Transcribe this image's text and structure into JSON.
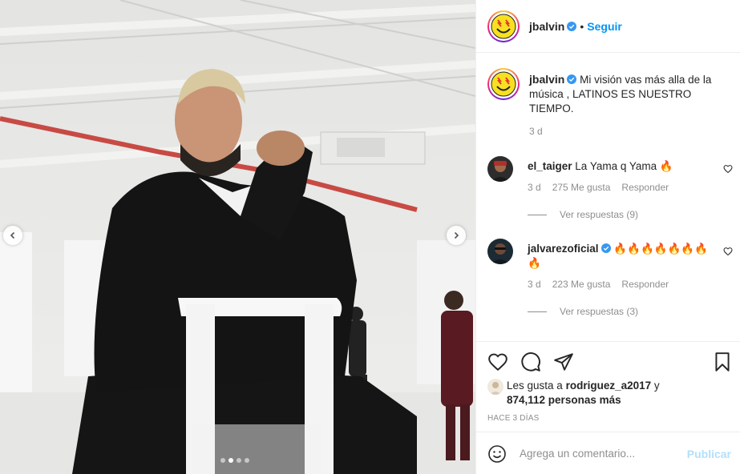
{
  "post": {
    "author": "jbalvin",
    "follow_label": "Seguir",
    "separator": "•",
    "caption": "Mi visión vas más alla de la música , LATINOS ES NUESTRO TIEMPO.",
    "caption_time": "3 d"
  },
  "comments": [
    {
      "user": "el_taiger",
      "text": "La Yama q Yama 🔥",
      "time": "3 d",
      "likes": "275 Me gusta",
      "reply": "Responder",
      "replies": "Ver respuestas (9)",
      "verified": false
    },
    {
      "user": "jalvarezoficial",
      "text": "🔥🔥🔥🔥🔥🔥🔥🔥",
      "time": "3 d",
      "likes": "223 Me gusta",
      "reply": "Responder",
      "replies": "Ver respuestas (3)",
      "verified": true
    }
  ],
  "likes": {
    "prefix": "Les gusta a",
    "user": "rodriguez_a2017",
    "conj": "y",
    "count": "874,112 personas más"
  },
  "time_ago": "HACE 3 DÍAS",
  "add_comment": {
    "placeholder": "Agrega un comentario...",
    "publish_label": "Publicar"
  },
  "carousel": {
    "total_slides": 4,
    "active_slide": 2
  },
  "icons": {
    "header_avatar": "smiley-logo-icon",
    "heart": "heart-icon",
    "comment": "comment-icon",
    "share": "paper-plane-icon",
    "save": "bookmark-icon",
    "emoji": "smiley-icon",
    "prev": "chevron-left-icon",
    "next": "chevron-right-icon"
  },
  "colors": {
    "follow": "#0095f6",
    "muted": "#8e8e8e",
    "publish_disabled": "#b2dffc",
    "verified": "#3897f0"
  }
}
